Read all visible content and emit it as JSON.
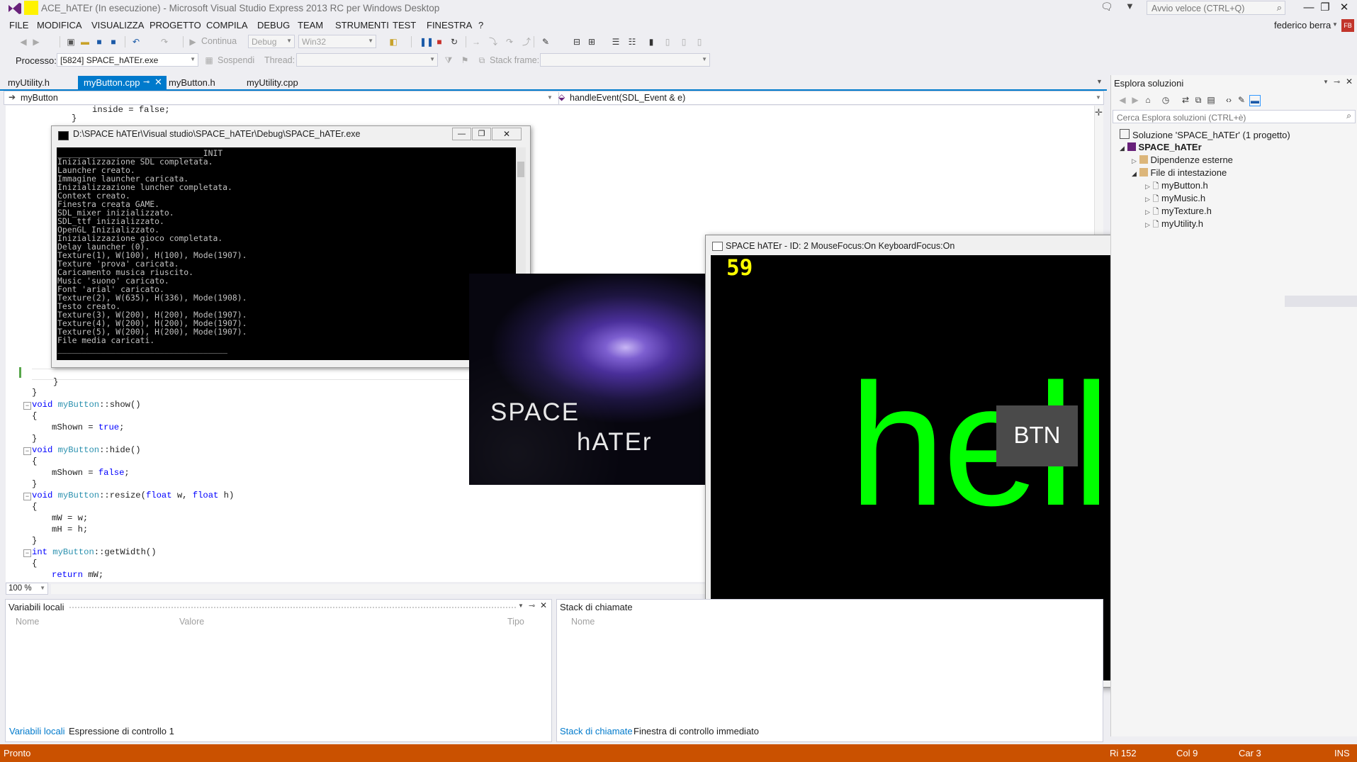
{
  "window": {
    "title": "SPACE_hATEr (In esecuzione) - Microsoft Visual Studio Express 2013 RC per Windows Desktop",
    "title_visible": "ACE_hATEr (In esecuzione) - Microsoft Visual Studio Express 2013 RC per Windows Desktop",
    "quick_launch_placeholder": "Avvio veloce (CTRL+Q)",
    "user": "federico berra",
    "user_initials": "FB",
    "controls": {
      "minimize": "—",
      "restore": "❐",
      "close": "✕"
    }
  },
  "menu": [
    "FILE",
    "MODIFICA",
    "VISUALIZZA",
    "PROGETTO",
    "COMPILA",
    "DEBUG",
    "TEAM",
    "STRUMENTI",
    "TEST",
    "FINESTRA",
    "?"
  ],
  "toolbar": {
    "continue_label": "Continua",
    "config": "Debug",
    "platform": "Win32",
    "process_label": "Processo:",
    "process_value": "[5824] SPACE_hATEr.exe",
    "suspend_label": "Sospendi",
    "thread_label": "Thread:",
    "stackframe_label": "Stack frame:"
  },
  "tabs": [
    {
      "label": "myUtility.h",
      "active": false
    },
    {
      "label": "myButton.cpp",
      "active": true
    },
    {
      "label": "myButton.h",
      "active": false
    },
    {
      "label": "myUtility.cpp",
      "active": false
    }
  ],
  "navbar": {
    "scope": "myButton",
    "member": "handleEvent(SDL_Event & e)"
  },
  "editor": {
    "zoom": "100 %",
    "lines": {
      "l0": "inside = false;",
      "l1": "}",
      "l2": "}",
      "l3a": "void",
      "l3b": "myButton",
      "l3c": "::show()",
      "l4": "{",
      "l5a": "mShown = ",
      "l5b": "true",
      "l5c": ";",
      "l6": "}",
      "l7a": "void",
      "l7b": "myButton",
      "l7c": "::hide()",
      "l8": "{",
      "l9a": "mShown = ",
      "l9b": "false",
      "l9c": ";",
      "l10": "}",
      "l11a": "void",
      "l11b": "myButton",
      "l11c": "::resize(",
      "l11d": "float",
      "l11e": " w, ",
      "l11f": "float",
      "l11g": " h)",
      "l12": "{",
      "l13": "mW = w;",
      "l14": "mH = h;",
      "l15": "}",
      "l16a": "int",
      "l16b": "myButton",
      "l16c": "::getWidth()",
      "l17": "{",
      "l18a": "return",
      "l18b": " mW;"
    }
  },
  "console": {
    "title": "D:\\SPACE hATEr\\Visual studio\\SPACE_hATEr\\Debug\\SPACE_hATEr.exe",
    "text": "______________________________INIT\nInizializzazione SDL completata.\nLauncher creato.\nImmagine launcher caricata.\nInizializzazione luncher completata.\nContext creato.\nFinestra creata GAME.\nSDL_mixer inizializzato.\nSDL_ttf inizializzato.\nOpenGL Inizializzato.\nInizializzazione gioco completata.\nDelay launcher (0).\nTexture(1), W(100), H(100), Mode(1907).\nTexture 'prova' caricata.\nCaricamento musica riuscito.\nMusic 'suono' caricato.\nFont 'arial' caricato.\nTexture(2), W(635), H(336), Mode(1908).\nTesto creato.\nTexture(3), W(200), H(200), Mode(1907).\nTexture(4), W(200), H(200), Mode(1907).\nTexture(5), W(200), H(200), Mode(1907).\nFile media caricati.\n___________________________________"
  },
  "launcher": {
    "line1": "SPACE",
    "line2": "hATEr"
  },
  "game": {
    "title": "SPACE hATEr - ID: 2 MouseFocus:On KeyboardFocus:On",
    "fps": "59",
    "hello": "hello",
    "button": "BTN"
  },
  "solution_explorer": {
    "title": "Esplora soluzioni",
    "search_placeholder": "Cerca Esplora soluzioni (CTRL+è)",
    "solution": "Soluzione 'SPACE_hATEr'  (1 progetto)",
    "project": "SPACE_hATEr",
    "folders": [
      "Dipendenze esterne",
      "File di intestazione"
    ],
    "headers": [
      "myButton.h",
      "myMusic.h",
      "myTexture.h",
      "myUtility.h"
    ]
  },
  "locals": {
    "title": "Variabili locali",
    "cols": [
      "Nome",
      "Valore",
      "Tipo"
    ],
    "tabs": [
      "Variabili locali",
      "Espressione di controllo 1"
    ]
  },
  "callstack": {
    "title": "Stack di chiamate",
    "cols": [
      "Nome"
    ],
    "tabs": [
      "Stack di chiamate",
      "Finestra di controllo immediato"
    ]
  },
  "status": {
    "ready": "Pronto",
    "row": "Ri 152",
    "col": "Col 9",
    "char": "Car 3",
    "mode": "INS"
  },
  "colors": {
    "accent": "#007acc",
    "debug_status": "#ca5100",
    "hello": "#00ff00",
    "fps": "#ffff00"
  }
}
